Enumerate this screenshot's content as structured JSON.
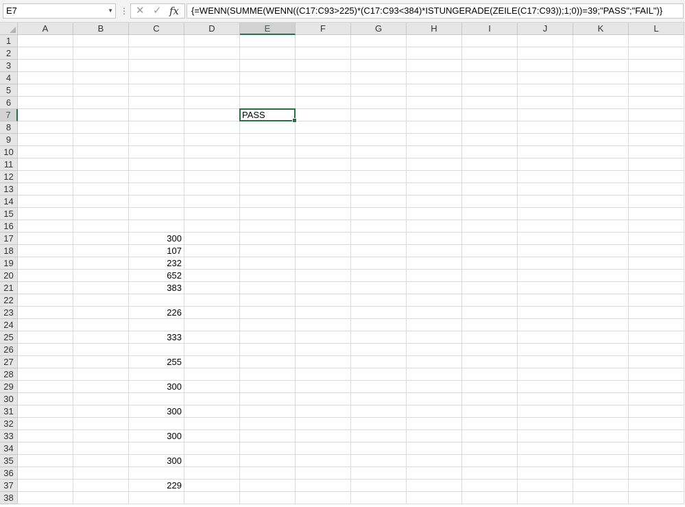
{
  "name_box": {
    "value": "E7"
  },
  "formula_bar": {
    "cancel_glyph": "✕",
    "enter_glyph": "✓",
    "fx_label": "fx",
    "formula": "{=WENN(SUMME(WENN((C17:C93>225)*(C17:C93<384)*ISTUNGERADE(ZEILE(C17:C93));1;0))=39;\"PASS\";\"FAIL\")}"
  },
  "active_cell": {
    "col": "E",
    "row": 7
  },
  "columns": [
    "A",
    "B",
    "C",
    "D",
    "E",
    "F",
    "G",
    "H",
    "I",
    "J",
    "K",
    "L"
  ],
  "rows": [
    1,
    2,
    3,
    4,
    5,
    6,
    7,
    8,
    9,
    10,
    11,
    12,
    13,
    14,
    15,
    16,
    17,
    18,
    19,
    20,
    21,
    22,
    23,
    24,
    25,
    26,
    27,
    28,
    29,
    30,
    31,
    32,
    33,
    34,
    35,
    36,
    37,
    38
  ],
  "cells": [
    {
      "ref": "E7",
      "value": "PASS",
      "type": "text"
    },
    {
      "ref": "C17",
      "value": "300",
      "type": "number"
    },
    {
      "ref": "C18",
      "value": "107",
      "type": "number"
    },
    {
      "ref": "C19",
      "value": "232",
      "type": "number"
    },
    {
      "ref": "C20",
      "value": "652",
      "type": "number"
    },
    {
      "ref": "C21",
      "value": "383",
      "type": "number"
    },
    {
      "ref": "C23",
      "value": "226",
      "type": "number"
    },
    {
      "ref": "C25",
      "value": "333",
      "type": "number"
    },
    {
      "ref": "C27",
      "value": "255",
      "type": "number"
    },
    {
      "ref": "C29",
      "value": "300",
      "type": "number"
    },
    {
      "ref": "C31",
      "value": "300",
      "type": "number"
    },
    {
      "ref": "C33",
      "value": "300",
      "type": "number"
    },
    {
      "ref": "C35",
      "value": "300",
      "type": "number"
    },
    {
      "ref": "C37",
      "value": "229",
      "type": "number"
    }
  ],
  "colors": {
    "accent": "#217346",
    "gridline": "#dadada",
    "header_bg": "#e6e6e6"
  }
}
